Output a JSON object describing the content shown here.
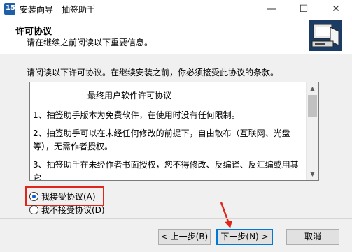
{
  "window": {
    "title": "安装向导 - 抽签助手",
    "icon_label": "15"
  },
  "header": {
    "title": "许可协议",
    "subtitle": "请在继续之前阅读以下重要信息。"
  },
  "intro": "请阅读以下许可协议。在继续安装之前，你必须接受此协议的条款。",
  "license": {
    "title": "最终用户软件许可协议",
    "paragraphs": [
      "1、抽签助手版本为免费软件，在使用时没有任何限制。",
      "2、抽签助手可以在未经任何修改的前提下，自由散布（互联网、光盘等），无需作者授权。",
      "3、抽签助手在未经作者书面授权，您不得修改、反编译、反汇编或用其它"
    ]
  },
  "options": {
    "accept": "我接受协议(A)",
    "reject": "我不接受协议(D)",
    "selected": "accept"
  },
  "buttons": {
    "back": "< 上一步(B)",
    "next": "下一步(N) >",
    "cancel": "取消"
  },
  "colors": {
    "highlight": "#e0251b",
    "accent": "#0078d7"
  }
}
